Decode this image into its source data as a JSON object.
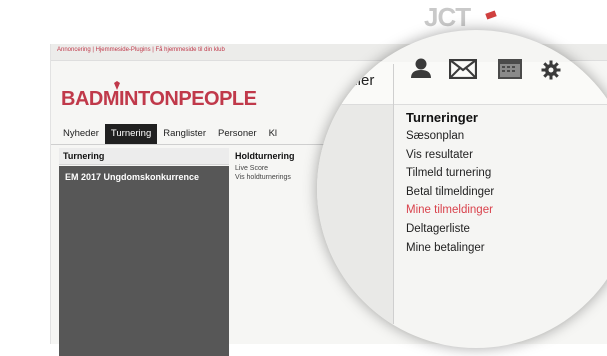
{
  "topbar": {
    "links": "Annoncering | Hjemmeside-Plugins | Få hjemmeside til din klub"
  },
  "brand": {
    "logo_part1": "BADMINTON",
    "logo_part2": "PEOPLE",
    "partial_logo": "JCT"
  },
  "nav": {
    "items": [
      {
        "label": "Nyheder",
        "active": false
      },
      {
        "label": "Turnering",
        "active": true
      },
      {
        "label": "Ranglister",
        "active": false
      },
      {
        "label": "Personer",
        "active": false
      },
      {
        "label": "Kl",
        "active": false
      }
    ]
  },
  "left_panel": {
    "header": "Turnering",
    "title": "EM 2017 Ungdomskonkurrence"
  },
  "mid_panel": {
    "header": "Holdturnering",
    "links": [
      "Live Score",
      "Vis holdturnerings"
    ]
  },
  "lens": {
    "moduler_label": "duler",
    "icons": [
      "user-icon",
      "mail-icon",
      "calendar-icon",
      "gear-icon"
    ],
    "menu": {
      "title": "Turneringer",
      "items": [
        {
          "label": "Sæsonplan",
          "highlight": false
        },
        {
          "label": "Vis resultater",
          "highlight": false
        },
        {
          "label": "Tilmeld turnering",
          "highlight": false
        },
        {
          "label": "Betal tilmeldinger",
          "highlight": false
        },
        {
          "label": "Mine tilmeldinger",
          "highlight": true
        },
        {
          "label": "Deltagerliste",
          "highlight": false
        },
        {
          "label": "Mine betalinger",
          "highlight": false
        }
      ]
    }
  },
  "colors": {
    "brand_red": "#c0394a",
    "highlight_red": "#d9424c",
    "active_nav": "#202020"
  }
}
